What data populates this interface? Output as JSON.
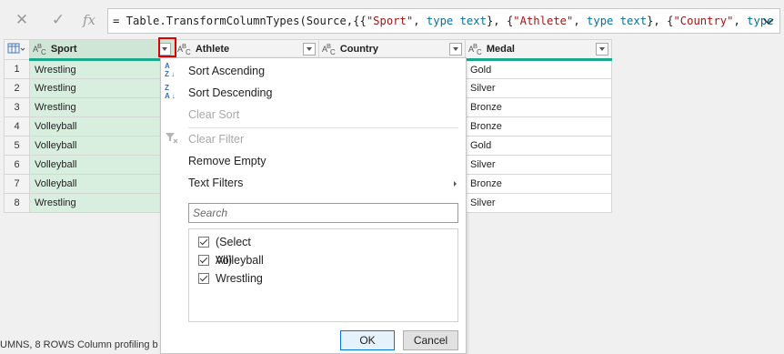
{
  "formula_bar": {
    "cancel_icon": "close-icon",
    "commit_icon": "check-icon",
    "fx_label": "fx",
    "formula_prefix": "= Table.TransformColumnTypes(Source,{{",
    "tok1": "\"Sport\"",
    "tok2": ", ",
    "tok3": "type text",
    "tok4": "}, {",
    "tok5": "\"Athlete\"",
    "tok6": ", ",
    "tok7": "type text",
    "tok8": "}, {",
    "tok9": "\"Country\"",
    "tok10": ", ",
    "tok11": "type text",
    "tok12": "},"
  },
  "grid": {
    "columns": [
      {
        "name": "Sport",
        "type": "ABC"
      },
      {
        "name": "Athlete",
        "type": "ABC"
      },
      {
        "name": "Country",
        "type": "ABC"
      },
      {
        "name": "Medal",
        "type": "ABC"
      }
    ],
    "type_icon_a": "A",
    "type_icon_bc": "B",
    "type_icon_c": "C",
    "rows": [
      {
        "n": "1",
        "sport": "Wrestling",
        "medal": "Gold"
      },
      {
        "n": "2",
        "sport": "Wrestling",
        "medal": "Silver"
      },
      {
        "n": "3",
        "sport": "Wrestling",
        "medal": "Bronze"
      },
      {
        "n": "4",
        "sport": "Volleyball",
        "medal": "Bronze"
      },
      {
        "n": "5",
        "sport": "Volleyball",
        "medal": "Gold"
      },
      {
        "n": "6",
        "sport": "Volleyball",
        "medal": "Silver"
      },
      {
        "n": "7",
        "sport": "Volleyball",
        "medal": "Bronze"
      },
      {
        "n": "8",
        "sport": "Wrestling",
        "medal": "Silver"
      }
    ]
  },
  "menu": {
    "sort_asc": "Sort Ascending",
    "sort_desc": "Sort Descending",
    "clear_sort": "Clear Sort",
    "clear_filter": "Clear Filter",
    "remove_empty": "Remove Empty",
    "text_filters": "Text Filters",
    "search_placeholder": "Search",
    "options": [
      "(Select All)",
      "Volleyball",
      "Wrestling"
    ],
    "ok": "OK",
    "cancel": "Cancel"
  },
  "status": {
    "text": "UMNS, 8 ROWS     Column profiling b"
  },
  "colors": {
    "selected_column": "#d8efdf",
    "header_underline": "#1aa88a",
    "highlight": "#e00000"
  }
}
